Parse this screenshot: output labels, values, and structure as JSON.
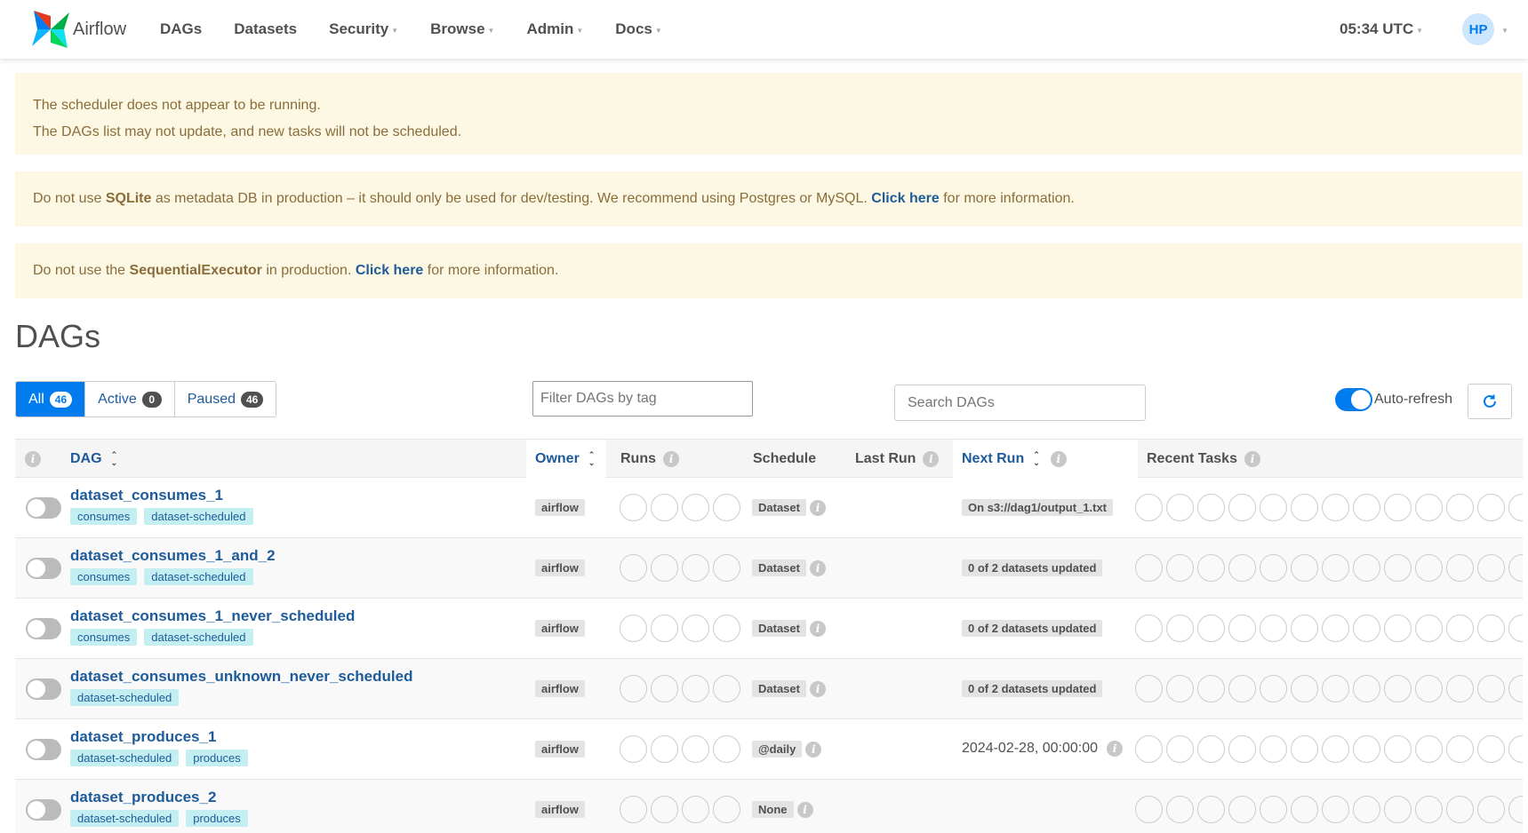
{
  "nav": {
    "brand": "Airflow",
    "items": [
      "DAGs",
      "Datasets",
      "Security",
      "Browse",
      "Admin",
      "Docs"
    ],
    "clock": "05:34 UTC",
    "user_initials": "HP"
  },
  "alerts": {
    "scheduler_line1": "The scheduler does not appear to be running.",
    "scheduler_line2": "The DAGs list may not update, and new tasks will not be scheduled.",
    "sqlite_pre": "Do not use ",
    "sqlite_bold": "SQLite",
    "sqlite_mid": " as metadata DB in production – it should only be used for dev/testing. We recommend using Postgres or MySQL. ",
    "sqlite_link": "Click here",
    "sqlite_post": " for more information.",
    "exec_pre": "Do not use the ",
    "exec_bold": "SequentialExecutor",
    "exec_mid": " in production. ",
    "exec_link": "Click here",
    "exec_post": " for more information."
  },
  "page_title": "DAGs",
  "filters": {
    "all_label": "All",
    "all_count": "46",
    "active_label": "Active",
    "active_count": "0",
    "paused_label": "Paused",
    "paused_count": "46",
    "tag_placeholder": "Filter DAGs by tag",
    "search_placeholder": "Search DAGs",
    "autorefresh_label": "Auto-refresh"
  },
  "columns": {
    "dag": "DAG",
    "owner": "Owner",
    "runs": "Runs",
    "schedule": "Schedule",
    "last_run": "Last Run",
    "next_run": "Next Run",
    "recent_tasks": "Recent Tasks"
  },
  "rows": [
    {
      "name": "dataset_consumes_1",
      "tags": [
        "consumes",
        "dataset-scheduled"
      ],
      "owner": "airflow",
      "schedule": "Dataset",
      "next_run": "On s3://dag1/output_1.txt",
      "next_type": "badge"
    },
    {
      "name": "dataset_consumes_1_and_2",
      "tags": [
        "consumes",
        "dataset-scheduled"
      ],
      "owner": "airflow",
      "schedule": "Dataset",
      "next_run": "0 of 2 datasets updated",
      "next_type": "badge"
    },
    {
      "name": "dataset_consumes_1_never_scheduled",
      "tags": [
        "consumes",
        "dataset-scheduled"
      ],
      "owner": "airflow",
      "schedule": "Dataset",
      "next_run": "0 of 2 datasets updated",
      "next_type": "badge"
    },
    {
      "name": "dataset_consumes_unknown_never_scheduled",
      "tags": [
        "dataset-scheduled"
      ],
      "owner": "airflow",
      "schedule": "Dataset",
      "next_run": "0 of 2 datasets updated",
      "next_type": "badge"
    },
    {
      "name": "dataset_produces_1",
      "tags": [
        "dataset-scheduled",
        "produces"
      ],
      "owner": "airflow",
      "schedule": "@daily",
      "next_run": "2024-02-28, 00:00:00",
      "next_type": "text"
    },
    {
      "name": "dataset_produces_2",
      "tags": [
        "dataset-scheduled",
        "produces"
      ],
      "owner": "airflow",
      "schedule": "None",
      "next_run": "",
      "next_type": "none"
    }
  ]
}
